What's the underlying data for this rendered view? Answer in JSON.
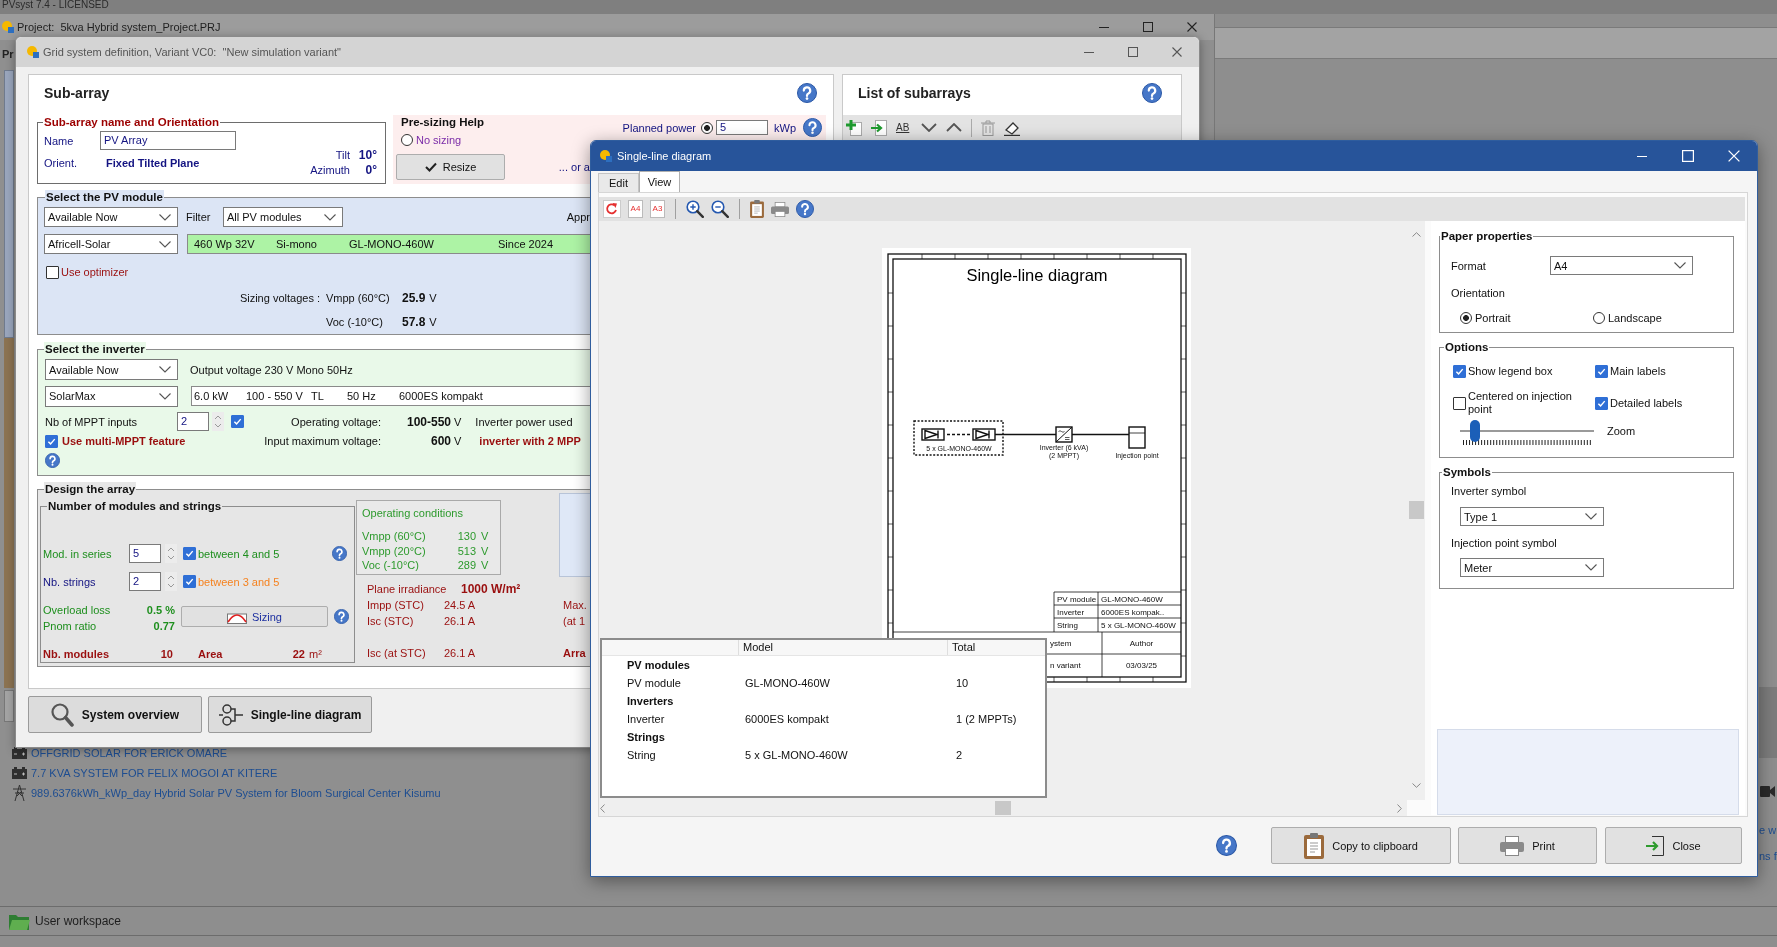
{
  "app": {
    "title": "PVsyst 7.4 - LICENSED"
  },
  "project_window": {
    "title": "Project:  5kva Hybrid system_Project.PRJ",
    "cut_label": "Pr",
    "projects": [
      {
        "kind": "battery",
        "label": "OFFGRID SOLAR FOR ERICK OMARE"
      },
      {
        "kind": "battery",
        "label": "7.7 KVA SYSTEM FOR FELIX MOGOI AT KITERE"
      },
      {
        "kind": "grid",
        "label": "989.6376kWh_kWp_day Hybrid Solar PV System for Bloom Surgical Center Kisumu"
      }
    ]
  },
  "edge_fragments": [
    "e w",
    "ns f"
  ],
  "workspace": {
    "label": "User workspace"
  },
  "grid_dialog": {
    "title": "Grid system definition, Variant VC0:  \"New simulation variant\"",
    "subarray": {
      "heading": "Sub-array",
      "name_orientation": {
        "title": "Sub-array name and Orientation",
        "name_label": "Name",
        "name_value": "PV Array",
        "orient_label": "Orient.",
        "orient_value": "Fixed Tilted Plane",
        "angles": [
          {
            "label": "Tilt",
            "value": "10°"
          },
          {
            "label": "Azimuth",
            "value": "0°"
          }
        ]
      },
      "presizing": {
        "title": "Pre-sizing Help",
        "no_sizing": {
          "label": "No sizing",
          "selected": false
        },
        "planned_power": {
          "label": "Planned power",
          "selected": true,
          "value": "5",
          "unit": "kWp"
        },
        "resize_button": "Resize",
        "alternative": "... or a"
      },
      "pv_module": {
        "title": "Select the PV module",
        "availability": "Available Now",
        "filter_label": "Filter",
        "filter": "All PV modules",
        "cut_label": "Appr",
        "manufacturer": "Africell-Solar",
        "module": [
          "460 Wp 32V",
          "Si-mono",
          "GL-MONO-460W",
          "Since 2024"
        ],
        "optimizer": {
          "label": "Use optimizer",
          "checked": false
        },
        "sizing_label": "Sizing voltages :",
        "voltages": [
          {
            "label": "Vmpp (60°C)",
            "value": "25.9",
            "unit": "V"
          },
          {
            "label": "Voc (-10°C)",
            "value": "57.8",
            "unit": "V"
          }
        ]
      },
      "inverter": {
        "title": "Select the inverter",
        "availability": "Available Now",
        "output": "Output voltage 230 V Mono 50Hz",
        "manufacturer": "SolarMax",
        "model": [
          "6.0 kW",
          "100 - 550 V",
          "TL",
          "50 Hz",
          "6000ES kompakt"
        ],
        "mppt_inputs": {
          "label": "Nb of MPPT inputs",
          "value": "2",
          "checked": true
        },
        "multi_mppt": {
          "label": "Use multi-MPPT feature",
          "checked": true
        },
        "specs": [
          {
            "label": "Operating voltage:",
            "value": "100-550",
            "unit": "V",
            "note": "Inverter power used",
            "highlighted": false
          },
          {
            "label": "Input maximum voltage:",
            "value": "600",
            "unit": "V",
            "note": "inverter with 2 MPP",
            "highlighted": true
          }
        ]
      },
      "design": {
        "title": "Design the array",
        "strings_title": "Number of modules and strings",
        "rows": [
          {
            "kind": "series",
            "label": "Mod. in series",
            "value": "5",
            "checked": true,
            "range": "between 4 and 5",
            "color": "#1e8f1e"
          },
          {
            "kind": "strings",
            "label": "Nb. strings",
            "value": "2",
            "checked": true,
            "range": "between 3 and 5",
            "color": "#f5821f"
          }
        ],
        "ratios": [
          {
            "label": "Overload loss",
            "value": "0.5 %"
          },
          {
            "label": "Pnom ratio",
            "value": "0.77"
          }
        ],
        "sizing_button": "Sizing",
        "totals": {
          "modules_label": "Nb. modules",
          "modules": "10",
          "area_label": "Area",
          "area": "22",
          "area_unit": "m²"
        },
        "operating": {
          "title": "Operating conditions",
          "rows": [
            {
              "label": "Vmpp (60°C)",
              "value": "130",
              "unit": "V"
            },
            {
              "label": "Vmpp (20°C)",
              "value": "513",
              "unit": "V"
            },
            {
              "label": "Voc (-10°C)",
              "value": "289",
              "unit": "V"
            }
          ]
        },
        "irradiance": {
          "label": "Plane irradiance",
          "value": "1000 W/m²"
        },
        "currents": [
          {
            "label": "Impp (STC)",
            "value": "24.5 A",
            "side": "Max."
          },
          {
            "label": "Isc (STC)",
            "value": "26.1 A",
            "side": "(at 1"
          }
        ],
        "array_current": {
          "label": "Isc (at STC)",
          "value": "26.1 A",
          "side": "Arra"
        }
      }
    },
    "subarray_list": {
      "heading": "List of subarrays",
      "toolbar": [
        {
          "kind": "add"
        },
        {
          "kind": "import"
        },
        {
          "kind": "rename",
          "label": "AB"
        },
        {
          "kind": "down"
        },
        {
          "kind": "up"
        },
        {
          "kind": "separator"
        },
        {
          "kind": "delete"
        },
        {
          "kind": "erase"
        }
      ]
    },
    "buttons": [
      {
        "kind": "overview",
        "label": "System overview"
      },
      {
        "kind": "diagram",
        "label": "Single-line diagram"
      }
    ]
  },
  "sld_window": {
    "title": "Single-line diagram",
    "tabs": [
      {
        "label": "Edit",
        "selected": false
      },
      {
        "label": "View",
        "selected": true
      }
    ],
    "toolbar": [
      {
        "kind": "refresh"
      },
      {
        "kind": "page",
        "label": "A4"
      },
      {
        "kind": "page",
        "label": "A3"
      },
      {
        "kind": "separator"
      },
      {
        "kind": "zoom_in"
      },
      {
        "kind": "zoom_out"
      },
      {
        "kind": "separator"
      },
      {
        "kind": "clipboard"
      },
      {
        "kind": "print"
      },
      {
        "kind": "help"
      }
    ],
    "diagram": {
      "title": "Single-line diagram",
      "string_label": "5 x GL-MONO-460W",
      "inverter_label": "Inverter (6 kVA)",
      "inverter_mppt": "(2 MPPT)",
      "injection_label": "Injection point",
      "legend": [
        {
          "name": "PV module",
          "value": "GL-MONO-460W"
        },
        {
          "name": "Inverter",
          "value": "6000ES kompak.."
        },
        {
          "name": "String",
          "value": "5 x GL-MONO-460W"
        }
      ],
      "title_block": [
        {
          "name": "ystem",
          "value": "Author"
        },
        {
          "name": "n variant",
          "value": "03/03/25"
        }
      ]
    },
    "summary": {
      "columns": [
        "Model",
        "Total"
      ],
      "groups": [
        {
          "title": "PV modules",
          "rows": [
            {
              "item": "PV module",
              "model": "GL-MONO-460W",
              "total": "10"
            }
          ]
        },
        {
          "title": "Inverters",
          "rows": [
            {
              "item": "Inverter",
              "model": "6000ES kompakt",
              "total": "1 (2 MPPTs)"
            }
          ]
        },
        {
          "title": "Strings",
          "rows": [
            {
              "item": "String",
              "model": "5 x GL-MONO-460W",
              "total": "2"
            }
          ]
        }
      ]
    },
    "paper": {
      "title": "Paper properties",
      "format_label": "Format",
      "format": "A4",
      "orientation_label": "Orientation",
      "orientations": [
        {
          "label": "Portrait",
          "selected": true
        },
        {
          "label": "Landscape",
          "selected": false
        }
      ]
    },
    "options": {
      "title": "Options",
      "checkboxes": [
        {
          "label": "Show legend box",
          "checked": true
        },
        {
          "label": "Main labels",
          "checked": true
        },
        {
          "label": "Centered on injection point",
          "checked": false
        },
        {
          "label": "Detailed labels",
          "checked": true
        }
      ],
      "zoom": {
        "label": "Zoom",
        "level": 0.08
      }
    },
    "symbols": {
      "title": "Symbols",
      "fields": [
        {
          "label": "Inverter symbol",
          "value": "Type 1"
        },
        {
          "label": "Injection point symbol",
          "value": "Meter"
        }
      ]
    },
    "buttons": [
      {
        "kind": "clipboard",
        "label": "Copy to clipboard"
      },
      {
        "kind": "print",
        "label": "Print"
      },
      {
        "kind": "close",
        "label": "Close"
      }
    ]
  }
}
